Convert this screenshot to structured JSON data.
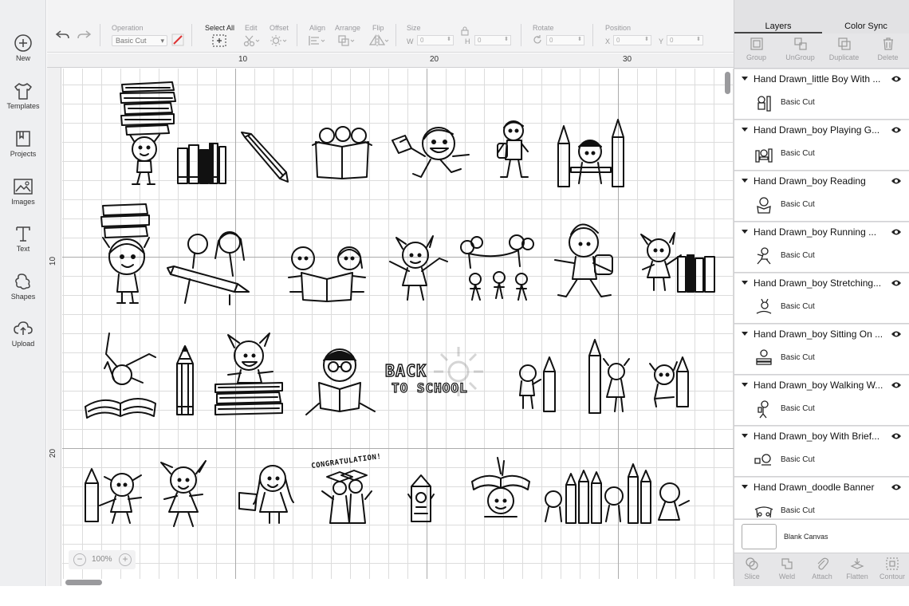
{
  "sidebar": {
    "items": [
      {
        "label": "New",
        "icon": "plus-circle-icon"
      },
      {
        "label": "Templates",
        "icon": "tshirt-icon"
      },
      {
        "label": "Projects",
        "icon": "projects-icon"
      },
      {
        "label": "Images",
        "icon": "image-icon"
      },
      {
        "label": "Text",
        "icon": "text-icon"
      },
      {
        "label": "Shapes",
        "icon": "shapes-icon"
      },
      {
        "label": "Upload",
        "icon": "upload-cloud-icon"
      }
    ]
  },
  "toolbar": {
    "operation_label": "Operation",
    "operation_value": "Basic Cut",
    "select_all_label": "Select All",
    "edit_label": "Edit",
    "offset_label": "Offset",
    "align_label": "Align",
    "arrange_label": "Arrange",
    "flip_label": "Flip",
    "size_label": "Size",
    "w_label": "W",
    "w_value": "0",
    "h_label": "H",
    "h_value": "0",
    "rotate_label": "Rotate",
    "rotate_value": "0",
    "position_label": "Position",
    "x_label": "X",
    "x_value": "0",
    "y_label": "Y",
    "y_value": "0"
  },
  "rulers": {
    "top": [
      "10",
      "20",
      "30"
    ],
    "left": [
      "10",
      "20"
    ]
  },
  "canvas": {
    "zoom": "100%",
    "art_text": {
      "back": "BACK",
      "to_school": "TO SCHOOL",
      "congratulation": "CONGRATULATION!"
    }
  },
  "panel": {
    "tabs": [
      "Layers",
      "Color Sync"
    ],
    "tools": [
      "Group",
      "UnGroup",
      "Duplicate",
      "Delete"
    ],
    "layers": [
      {
        "name": "Hand Drawn_little Boy With ...",
        "operation": "Basic Cut"
      },
      {
        "name": "Hand Drawn_boy Playing G...",
        "operation": "Basic Cut"
      },
      {
        "name": "Hand Drawn_boy Reading",
        "operation": "Basic Cut"
      },
      {
        "name": "Hand Drawn_boy Running ...",
        "operation": "Basic Cut"
      },
      {
        "name": "Hand Drawn_boy Stretching...",
        "operation": "Basic Cut"
      },
      {
        "name": "Hand Drawn_boy Sitting On ...",
        "operation": "Basic Cut"
      },
      {
        "name": "Hand Drawn_boy Walking W...",
        "operation": "Basic Cut"
      },
      {
        "name": "Hand Drawn_boy With Brief...",
        "operation": "Basic Cut"
      },
      {
        "name": "Hand Drawn_doodle Banner",
        "operation": "Basic Cut"
      }
    ],
    "blank_canvas": "Blank Canvas",
    "bottom_tools": [
      "Slice",
      "Weld",
      "Attach",
      "Flatten",
      "Contour"
    ]
  }
}
